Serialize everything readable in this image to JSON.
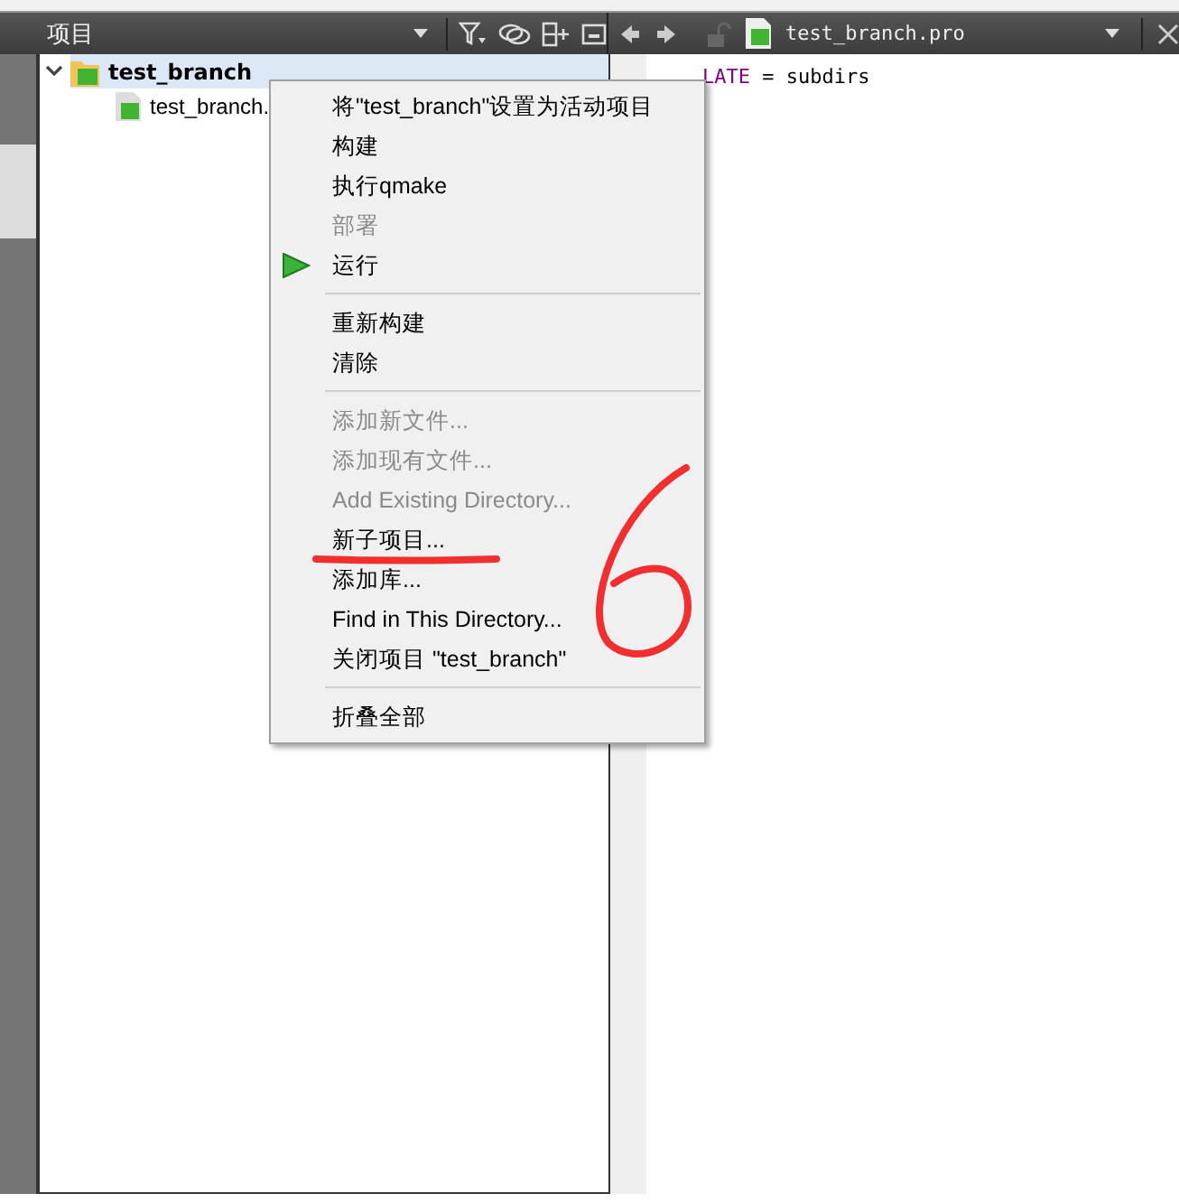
{
  "project_pane": {
    "title": "项目",
    "tree": [
      {
        "label": "test_branch",
        "expanded": true,
        "selected": true,
        "children": [
          {
            "label": "test_branch."
          }
        ]
      }
    ]
  },
  "editor": {
    "file_name": "test_branch.pro",
    "lines": [
      [
        {
          "text": "LATE",
          "kind": "keyword"
        },
        {
          "text": " = subdirs",
          "kind": "plain"
        }
      ]
    ]
  },
  "context_menu": [
    {
      "kind": "item",
      "label": "将\"test_branch\"设置为活动项目",
      "disabled": false
    },
    {
      "kind": "item",
      "label": "构建",
      "disabled": false
    },
    {
      "kind": "item",
      "label": "执行qmake",
      "disabled": false
    },
    {
      "kind": "item",
      "label": "部署",
      "disabled": true
    },
    {
      "kind": "run_item",
      "label": "运行",
      "disabled": false
    },
    {
      "kind": "separator"
    },
    {
      "kind": "item",
      "label": "重新构建",
      "disabled": false
    },
    {
      "kind": "item",
      "label": "清除",
      "disabled": false
    },
    {
      "kind": "separator"
    },
    {
      "kind": "item",
      "label": "添加新文件...",
      "disabled": true
    },
    {
      "kind": "item",
      "label": "添加现有文件...",
      "disabled": true
    },
    {
      "kind": "item",
      "label": "Add Existing Directory...",
      "disabled": true
    },
    {
      "kind": "item",
      "label": "新子项目...",
      "disabled": false
    },
    {
      "kind": "item",
      "label": "添加库...",
      "disabled": false
    },
    {
      "kind": "item",
      "label": "Find in This Directory...",
      "disabled": false
    },
    {
      "kind": "item",
      "label": "关闭项目 \"test_branch\"",
      "disabled": false
    },
    {
      "kind": "separator"
    },
    {
      "kind": "item",
      "label": "折叠全部",
      "disabled": false
    }
  ]
}
